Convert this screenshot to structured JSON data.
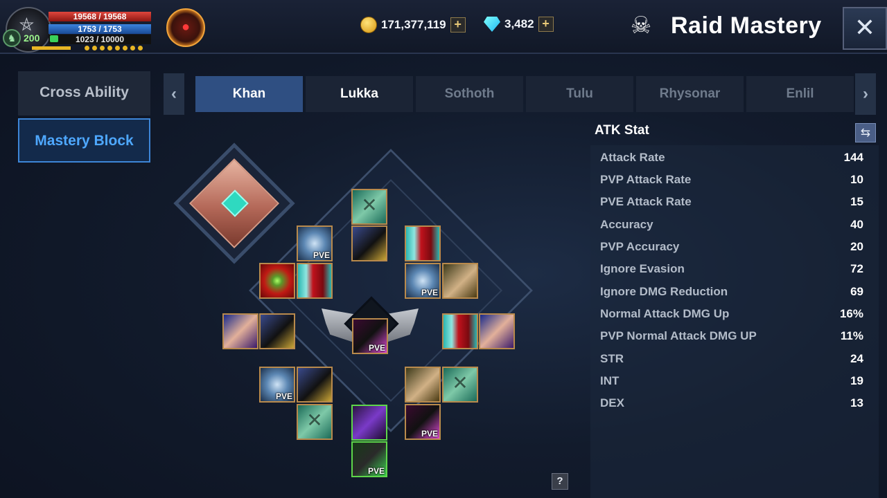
{
  "player": {
    "hp": "19568 / 19568",
    "mp": "1753 / 1753",
    "stamina": "1023 / 10000",
    "level": "200",
    "portrait_icon": "pentagram-icon",
    "guild_icon": "guild-crest-icon"
  },
  "currencies": {
    "gold": "171,377,119",
    "gems": "3,482",
    "add_label": "+"
  },
  "header": {
    "title": "Raid Mastery",
    "close_label": "✕"
  },
  "side_menu": {
    "cross_ability": "Cross Ability",
    "mastery_block": "Mastery Block"
  },
  "tabs": {
    "prev": "‹",
    "next": "›",
    "items": [
      "Khan",
      "Lukka",
      "Sothoth",
      "Tulu",
      "Rhysonar",
      "Enlil"
    ],
    "active_index": 0
  },
  "board": {
    "pve_label": "PVE",
    "help_label": "?"
  },
  "stats": {
    "title": "ATK Stat",
    "swap_label": "⇆",
    "rows": [
      {
        "name": "Attack Rate",
        "value": "144"
      },
      {
        "name": "PVP Attack Rate",
        "value": "10"
      },
      {
        "name": "PVE Attack Rate",
        "value": "15"
      },
      {
        "name": "Accuracy",
        "value": "40"
      },
      {
        "name": "PVP Accuracy",
        "value": "20"
      },
      {
        "name": "Ignore Evasion",
        "value": "72"
      },
      {
        "name": "Ignore DMG Reduction",
        "value": "69"
      },
      {
        "name": "Normal Attack DMG Up",
        "value": "16%"
      },
      {
        "name": "PVP Normal Attack DMG UP",
        "value": "11%"
      },
      {
        "name": "STR",
        "value": "24"
      },
      {
        "name": "INT",
        "value": "19"
      },
      {
        "name": "DEX",
        "value": "13"
      }
    ]
  },
  "colors": {
    "accent_blue": "#3d86d8",
    "active_tab": "#2f4f82",
    "hp_red": "#e0463d",
    "mp_blue": "#3b83de",
    "gold": "#e8b624"
  }
}
